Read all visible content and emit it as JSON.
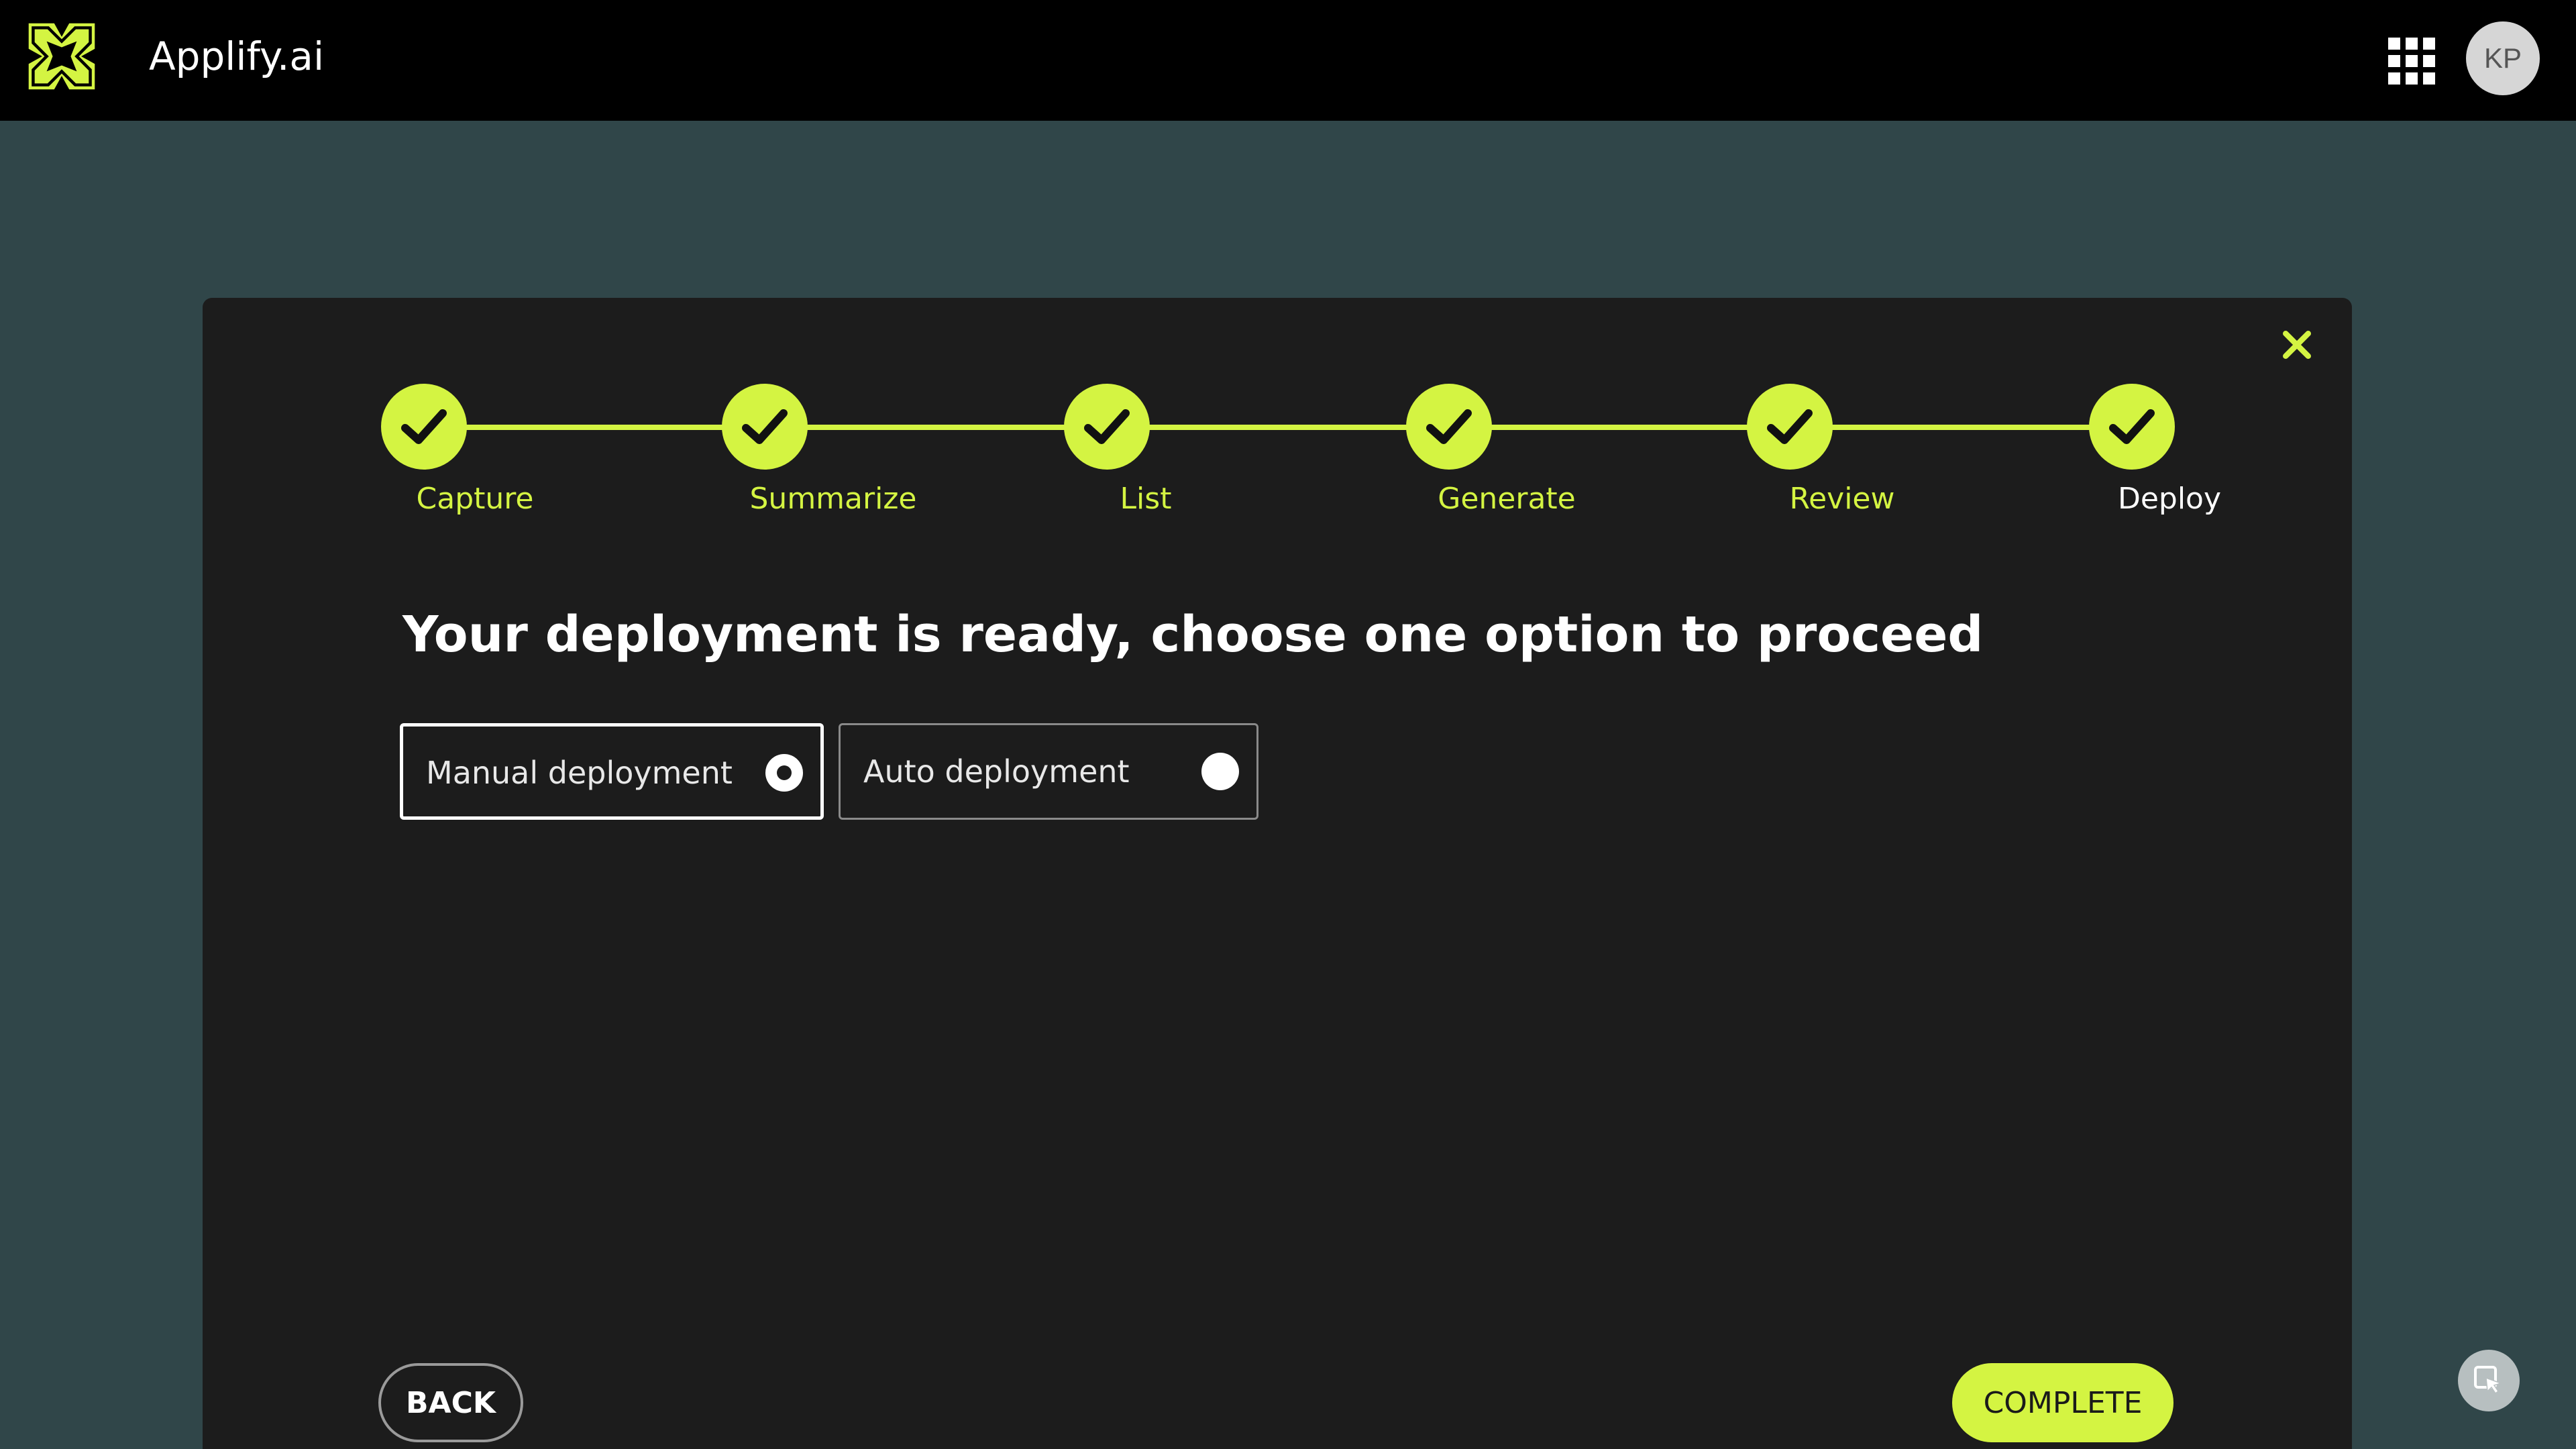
{
  "app": {
    "name": "Applify.ai",
    "logo_icon": "x-cross-logo-icon",
    "brand_color": "#d4f442"
  },
  "header": {
    "apps_icon": "grid-apps-icon",
    "avatar_initials": "KP"
  },
  "modal": {
    "close_icon": "close-icon",
    "heading": "Your deployment is ready, choose one option to proceed",
    "steps": [
      {
        "label": "Capture",
        "status": "completed"
      },
      {
        "label": "Summarize",
        "status": "completed"
      },
      {
        "label": "List",
        "status": "completed"
      },
      {
        "label": "Generate",
        "status": "completed"
      },
      {
        "label": "Review",
        "status": "completed"
      },
      {
        "label": "Deploy",
        "status": "current"
      }
    ],
    "options": [
      {
        "label": "Manual deployment",
        "selected": true
      },
      {
        "label": "Auto deployment",
        "selected": false
      }
    ],
    "back_label": "BACK",
    "complete_label": "COMPLETE"
  },
  "floating": {
    "icon": "cursor-select-icon"
  },
  "colors": {
    "background": "#304649",
    "topbar": "#000000",
    "modal": "#1c1c1c",
    "accent": "#d4f442"
  }
}
